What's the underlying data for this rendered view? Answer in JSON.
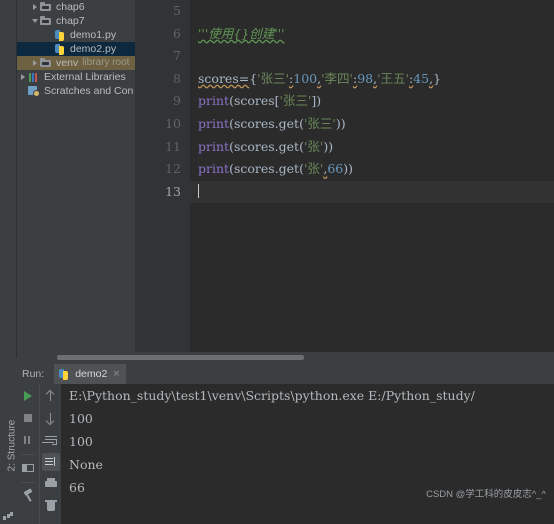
{
  "project": {
    "tree": [
      {
        "label": "chap6",
        "icon": "folder-icon",
        "arrow": "collapsed",
        "indent": 1,
        "state": "normal",
        "suffix": ""
      },
      {
        "label": "chap7",
        "icon": "folder-icon",
        "arrow": "expanded",
        "indent": 1,
        "state": "normal",
        "suffix": ""
      },
      {
        "label": "demo1.py",
        "icon": "python-file-icon",
        "arrow": "none",
        "indent": 2,
        "state": "normal",
        "suffix": ""
      },
      {
        "label": "demo2.py",
        "icon": "python-file-icon",
        "arrow": "none",
        "indent": 2,
        "state": "selected",
        "suffix": ""
      },
      {
        "label": "venv",
        "icon": "folder-icon",
        "arrow": "collapsed",
        "indent": 1,
        "state": "library-root",
        "suffix": "library root"
      },
      {
        "label": "External Libraries",
        "icon": "library-icon",
        "arrow": "collapsed",
        "indent": 0,
        "state": "normal",
        "suffix": ""
      },
      {
        "label": "Scratches and Con",
        "icon": "scratches-icon",
        "arrow": "none",
        "indent": 0,
        "state": "normal",
        "suffix": ""
      }
    ]
  },
  "editor": {
    "line_numbers": [
      "5",
      "6",
      "7",
      "8",
      "9",
      "10",
      "11",
      "12",
      "13"
    ],
    "current_line": "13",
    "lines": [
      {
        "n": "5",
        "text": ""
      },
      {
        "n": "6",
        "text": "'''使用{}创建'''"
      },
      {
        "n": "7",
        "text": ""
      },
      {
        "n": "8",
        "text": "scores={'张三':100,'李四':98,'王五':45,}"
      },
      {
        "n": "9",
        "text": "print(scores['张三'])"
      },
      {
        "n": "10",
        "text": "print(scores.get('张三'))"
      },
      {
        "n": "11",
        "text": "print(scores.get('张'))"
      },
      {
        "n": "12",
        "text": "print(scores.get('张',66))"
      },
      {
        "n": "13",
        "text": ""
      }
    ],
    "tokens": {
      "comment": "'''使用{}创建'''",
      "scores_assign_name": "scores=",
      "brace_open": "{",
      "k1": "'张三'",
      "colon1": ":",
      "v1": "100",
      "c1": ",",
      "k2": "'李四'",
      "colon2": ":",
      "v2": "98",
      "c2": ",",
      "k3": "'王五'",
      "colon3": ":",
      "v3": "45",
      "c3": ",",
      "brace_close": "}",
      "print_kw": "print",
      "l9_mid": "(scores[",
      "l9_str": "'张三'",
      "l9_end": "])",
      "l10_mid": "(scores.get(",
      "l10_str": "'张三'",
      "l10_end": "))",
      "l11_mid": "(scores.get(",
      "l11_str": "'张'",
      "l11_end": "))",
      "l12_mid": "(scores.get(",
      "l12_str": "'张'",
      "l12_comma": ",",
      "l12_num": "66",
      "l12_end": "))"
    }
  },
  "run_panel": {
    "run_label": "Run:",
    "tab_label": "demo2",
    "tab_close": "×",
    "structure_label": "2: Structure",
    "toolbar_left": [
      {
        "name": "run-button",
        "icon": "run-icon"
      },
      {
        "name": "stop-button",
        "icon": "stop-icon"
      },
      {
        "name": "pause-button",
        "icon": "pause-icon"
      },
      {
        "name": "layout-button",
        "icon": "layout-icon"
      },
      {
        "name": "pin-button",
        "icon": "pin-icon"
      }
    ],
    "toolbar_right": [
      {
        "name": "up-button",
        "icon": "arrow-up-icon"
      },
      {
        "name": "down-button",
        "icon": "arrow-down-icon"
      },
      {
        "name": "soft-wrap-button",
        "icon": "wrap-icon"
      },
      {
        "name": "scroll-to-end-button",
        "icon": "scroll-end-icon"
      },
      {
        "name": "print-button",
        "icon": "print-icon"
      },
      {
        "name": "clear-button",
        "icon": "trash-icon"
      }
    ],
    "console_lines": [
      "E:\\Python_study\\test1\\venv\\Scripts\\python.exe E:/Python_study/",
      "100",
      "100",
      "None",
      "66"
    ],
    "watermark": "CSDN @学工科的皮皮志^_^"
  },
  "colors": {
    "panel_bg": "#3c3f41",
    "editor_bg": "#2b2b2b",
    "gutter_bg": "#313335",
    "selection_blue": "#0d293f",
    "library_root": "#6e6142",
    "comment_green": "#629755",
    "string_green": "#6a8759",
    "number_blue": "#6897bb",
    "keyword_purple": "#8a73c8",
    "text_gray": "#a9b7c6",
    "run_green": "#499c54"
  }
}
